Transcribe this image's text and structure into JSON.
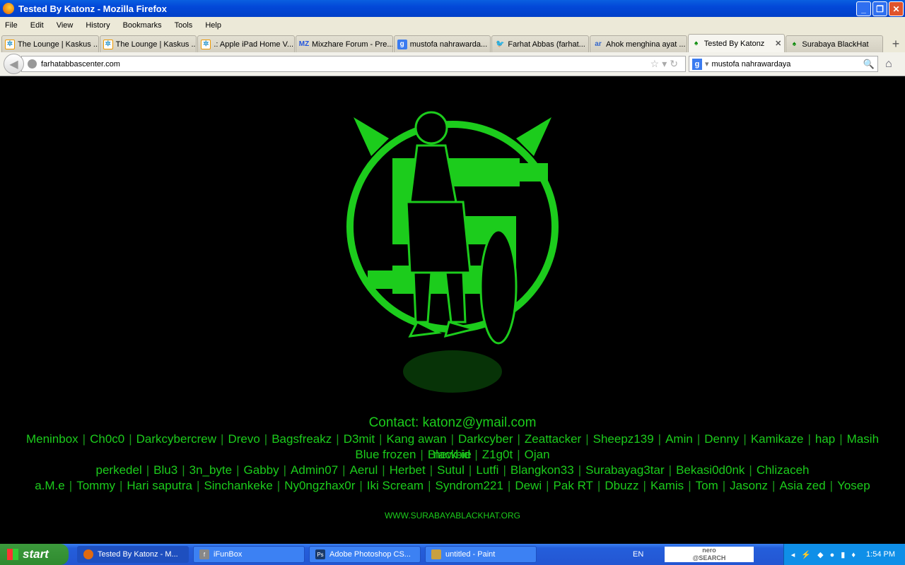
{
  "window": {
    "title": "Tested By Katonz - Mozilla Firefox",
    "minimize": "_",
    "restore": "❐",
    "close": "✕"
  },
  "menu": [
    "File",
    "Edit",
    "View",
    "History",
    "Bookmarks",
    "Tools",
    "Help"
  ],
  "tabs": [
    {
      "label": "The Lounge | Kaskus ...",
      "icon": "kaskus-icon"
    },
    {
      "label": "The Lounge | Kaskus ...",
      "icon": "kaskus-icon"
    },
    {
      "label": ".: Apple iPad Home V...",
      "icon": "kaskus-icon"
    },
    {
      "label": "Mixzhare Forum - Pre...",
      "icon": "mixzhare-icon"
    },
    {
      "label": "mustofa nahrawarda...",
      "icon": "google-icon"
    },
    {
      "label": "Farhat Abbas (farhat...",
      "icon": "twitter-icon"
    },
    {
      "label": "Ahok menghina ayat ...",
      "icon": "ar-icon"
    },
    {
      "label": "Tested By Katonz",
      "icon": "hacker-icon",
      "active": true
    },
    {
      "label": "Surabaya BlackHat",
      "icon": "hacker-icon"
    }
  ],
  "nav": {
    "url": "farhatabbascenter.com",
    "search": "mustofa nahrawardaya"
  },
  "page": {
    "contact": "Contact: katonz@ymail.com",
    "lines": [
      [
        "Meninbox",
        "Ch0c0",
        "Darkcybercrew",
        "Drevo",
        "Bagsfreakz",
        "D3mit",
        "Kang awan",
        "Darkcyber",
        "Zeattacker",
        "Sheepz139",
        "Amin",
        "Denny",
        "Kamikaze",
        "hap",
        "Masih newbie"
      ],
      [
        "Blue frozen",
        "Black-id",
        "Z1g0t",
        "Ojan perkedel",
        "Blu3",
        "3n_byte",
        "Gabby",
        "Admin07",
        "Aerul",
        "Herbet",
        "Sutul",
        "Lutfi",
        "Blangkon33",
        "Surabayag3tar",
        "Bekasi0d0nk",
        "Chlizaceh"
      ],
      [
        "a.M.e",
        "Tommy",
        "Hari saputra",
        "Sinchankeke",
        "Ny0ngzhax0r",
        "Iki Scream",
        "Syndrom221",
        "Dewi",
        "Pak RT",
        "Dbuzz",
        "Kamis",
        "Tom",
        "Jasonz",
        "Asia zed",
        "Yosep"
      ]
    ],
    "separator": "|",
    "website": "WWW.SURABAYABLACKHAT.ORG",
    "accent": "#1ccc1c"
  },
  "taskbar": {
    "start": "start",
    "tasks": [
      "Tested By Katonz - M...",
      "iFunBox",
      "Adobe Photoshop CS...",
      "untitled - Paint"
    ],
    "lang": "EN",
    "nero": "nero\n@SEARCH",
    "clock": "1:54 PM"
  }
}
